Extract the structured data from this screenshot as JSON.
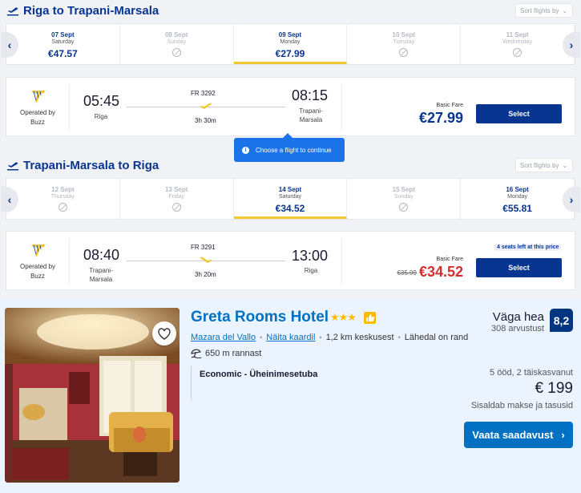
{
  "outbound": {
    "title": "Riga to Trapani-Marsala",
    "sort_label": "Sort flights by",
    "dates": [
      {
        "date": "07 Sept",
        "weekday": "Saturday",
        "price": "€47.57",
        "state": "available"
      },
      {
        "date": "08 Sept",
        "weekday": "Sunday",
        "price": "",
        "state": "disabled"
      },
      {
        "date": "09 Sept",
        "weekday": "Monday",
        "price": "€27.99",
        "state": "active"
      },
      {
        "date": "10 Sept",
        "weekday": "Tuesday",
        "price": "",
        "state": "disabled"
      },
      {
        "date": "11 Sept",
        "weekday": "Wednesday",
        "price": "",
        "state": "disabled"
      }
    ],
    "flight": {
      "operated_by": "Operated by Buzz",
      "dep_time": "05:45",
      "dep_city": "Riga",
      "flight_no": "FR 3292",
      "duration": "3h 30m",
      "arr_time": "08:15",
      "arr_city": "Trapani-Marsala",
      "fare_label": "Basic Fare",
      "price": "€27.99",
      "select_label": "Select"
    }
  },
  "tooltip": "Choose a flight to continue",
  "inbound": {
    "title": "Trapani-Marsala to Riga",
    "sort_label": "Sort flights by",
    "dates": [
      {
        "date": "12 Sept",
        "weekday": "Thursday",
        "price": "",
        "state": "disabled"
      },
      {
        "date": "13 Sept",
        "weekday": "Friday",
        "price": "",
        "state": "disabled"
      },
      {
        "date": "14 Sept",
        "weekday": "Saturday",
        "price": "€34.52",
        "state": "active"
      },
      {
        "date": "15 Sept",
        "weekday": "Sunday",
        "price": "",
        "state": "disabled"
      },
      {
        "date": "16 Sept",
        "weekday": "Monday",
        "price": "€55.81",
        "state": "available"
      }
    ],
    "flight": {
      "operated_by": "Operated by Buzz",
      "dep_time": "08:40",
      "dep_city": "Trapani-Marsala",
      "flight_no": "FR 3291",
      "duration": "3h 20m",
      "arr_time": "13:00",
      "arr_city": "Riga",
      "seats_left": "4 seats left at this price",
      "fare_label": "Basic Fare",
      "old_price": "€35.99",
      "price": "€34.52",
      "select_label": "Select"
    }
  },
  "hotel": {
    "name": "Greta Rooms Hotel",
    "stars": "★★★",
    "location": "Mazara del Vallo",
    "map_link": "Näita kaardil",
    "distance": "1,2 km keskusest",
    "beach_near": "Lähedal on rand",
    "beach_distance": "650 m rannast",
    "room": "Economic - Üheinimesetuba",
    "rating_word": "Väga hea",
    "reviews": "308 arvustust",
    "score": "8,2",
    "stay": "5 ööd, 2 täiskasvanut",
    "price": "€ 199",
    "taxes": "Sisaldab makse ja tasusid",
    "cta": "Vaata saadavust"
  },
  "colors": {
    "brand_blue": "#073590",
    "yellow": "#f1c933",
    "booking_blue": "#0071c2",
    "score_bg": "#003580",
    "sale_red": "#d32f2f"
  }
}
